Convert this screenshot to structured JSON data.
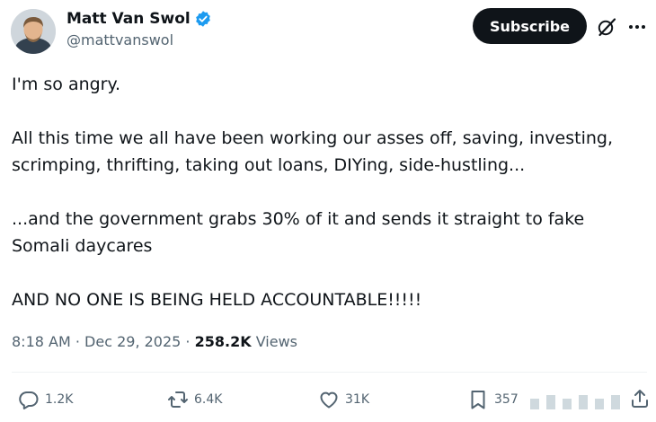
{
  "author": {
    "display_name": "Matt Van Swol",
    "handle": "@mattvanswol",
    "verified": true
  },
  "header": {
    "subscribe_label": "Subscribe"
  },
  "tweet": {
    "text": "I'm so angry.\n\nAll this time we all have been working our asses off, saving, investing, scrimping, thrifting, taking out loans, DIYing, side-hustling...\n\n...and the government grabs 30% of it and sends it straight to fake Somali daycares\n\nAND NO ONE IS BEING HELD ACCOUNTABLE!!!!!",
    "time": "8:18 AM",
    "separator": " · ",
    "date": "Dec 29, 2025",
    "views_count": "258.2K",
    "views_label": " Views"
  },
  "actions": {
    "replies": "1.2K",
    "reposts": "6.4K",
    "likes": "31K",
    "bookmarks": "357"
  },
  "icons": {
    "verified": "verified-badge-icon",
    "grok": "grok-icon",
    "more": "more-dots-icon",
    "reply": "reply-icon",
    "repost": "repost-icon",
    "like": "heart-icon",
    "bookmark": "bookmark-icon",
    "share": "share-icon"
  },
  "colors": {
    "text_primary": "#0f1419",
    "text_secondary": "#536471",
    "verified_blue": "#1d9bf0",
    "divider": "#eff3f4",
    "button_dark": "#0f1419"
  }
}
